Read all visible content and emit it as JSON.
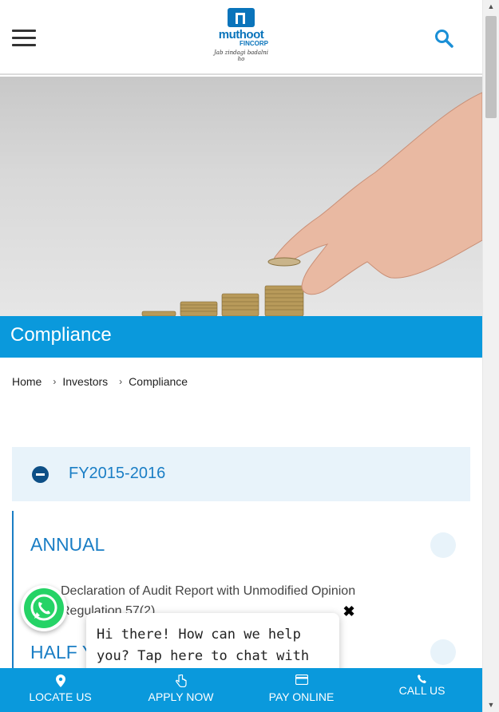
{
  "header": {
    "menu_icon": "hamburger-menu-icon",
    "logo": {
      "word": "muthoot",
      "sub": "FINCORP",
      "tagline": "Jab zindagi badalni ho"
    },
    "search_icon": "search-icon"
  },
  "hero": {
    "image": "hand-placing-coins-photo"
  },
  "page_title": "Compliance",
  "breadcrumb": {
    "items": [
      "Home",
      "Investors",
      "Compliance"
    ],
    "separator": "›"
  },
  "accordion": {
    "year": "FY2015-2016",
    "sections": [
      {
        "title": "ANNUAL",
        "items": [
          "Declaration of Audit Report with Unmodified Opinion Regulation 57(2)"
        ]
      },
      {
        "title": "HALF Y",
        "items": []
      }
    ]
  },
  "chat": {
    "message": "Hi there! How can we help you? Tap here to chat with us.",
    "close": "✖"
  },
  "bottom_nav": [
    {
      "label": "LOCATE US",
      "icon": "map-pin-icon"
    },
    {
      "label": "APPLY NOW",
      "icon": "hand-pointer-icon"
    },
    {
      "label": "PAY ONLINE",
      "icon": "credit-card-icon"
    },
    {
      "label": "CALL US",
      "icon": "phone-icon"
    }
  ],
  "colors": {
    "brand_blue": "#0a99dc",
    "link_blue": "#1a7ec5",
    "whatsapp_green": "#25d366"
  }
}
